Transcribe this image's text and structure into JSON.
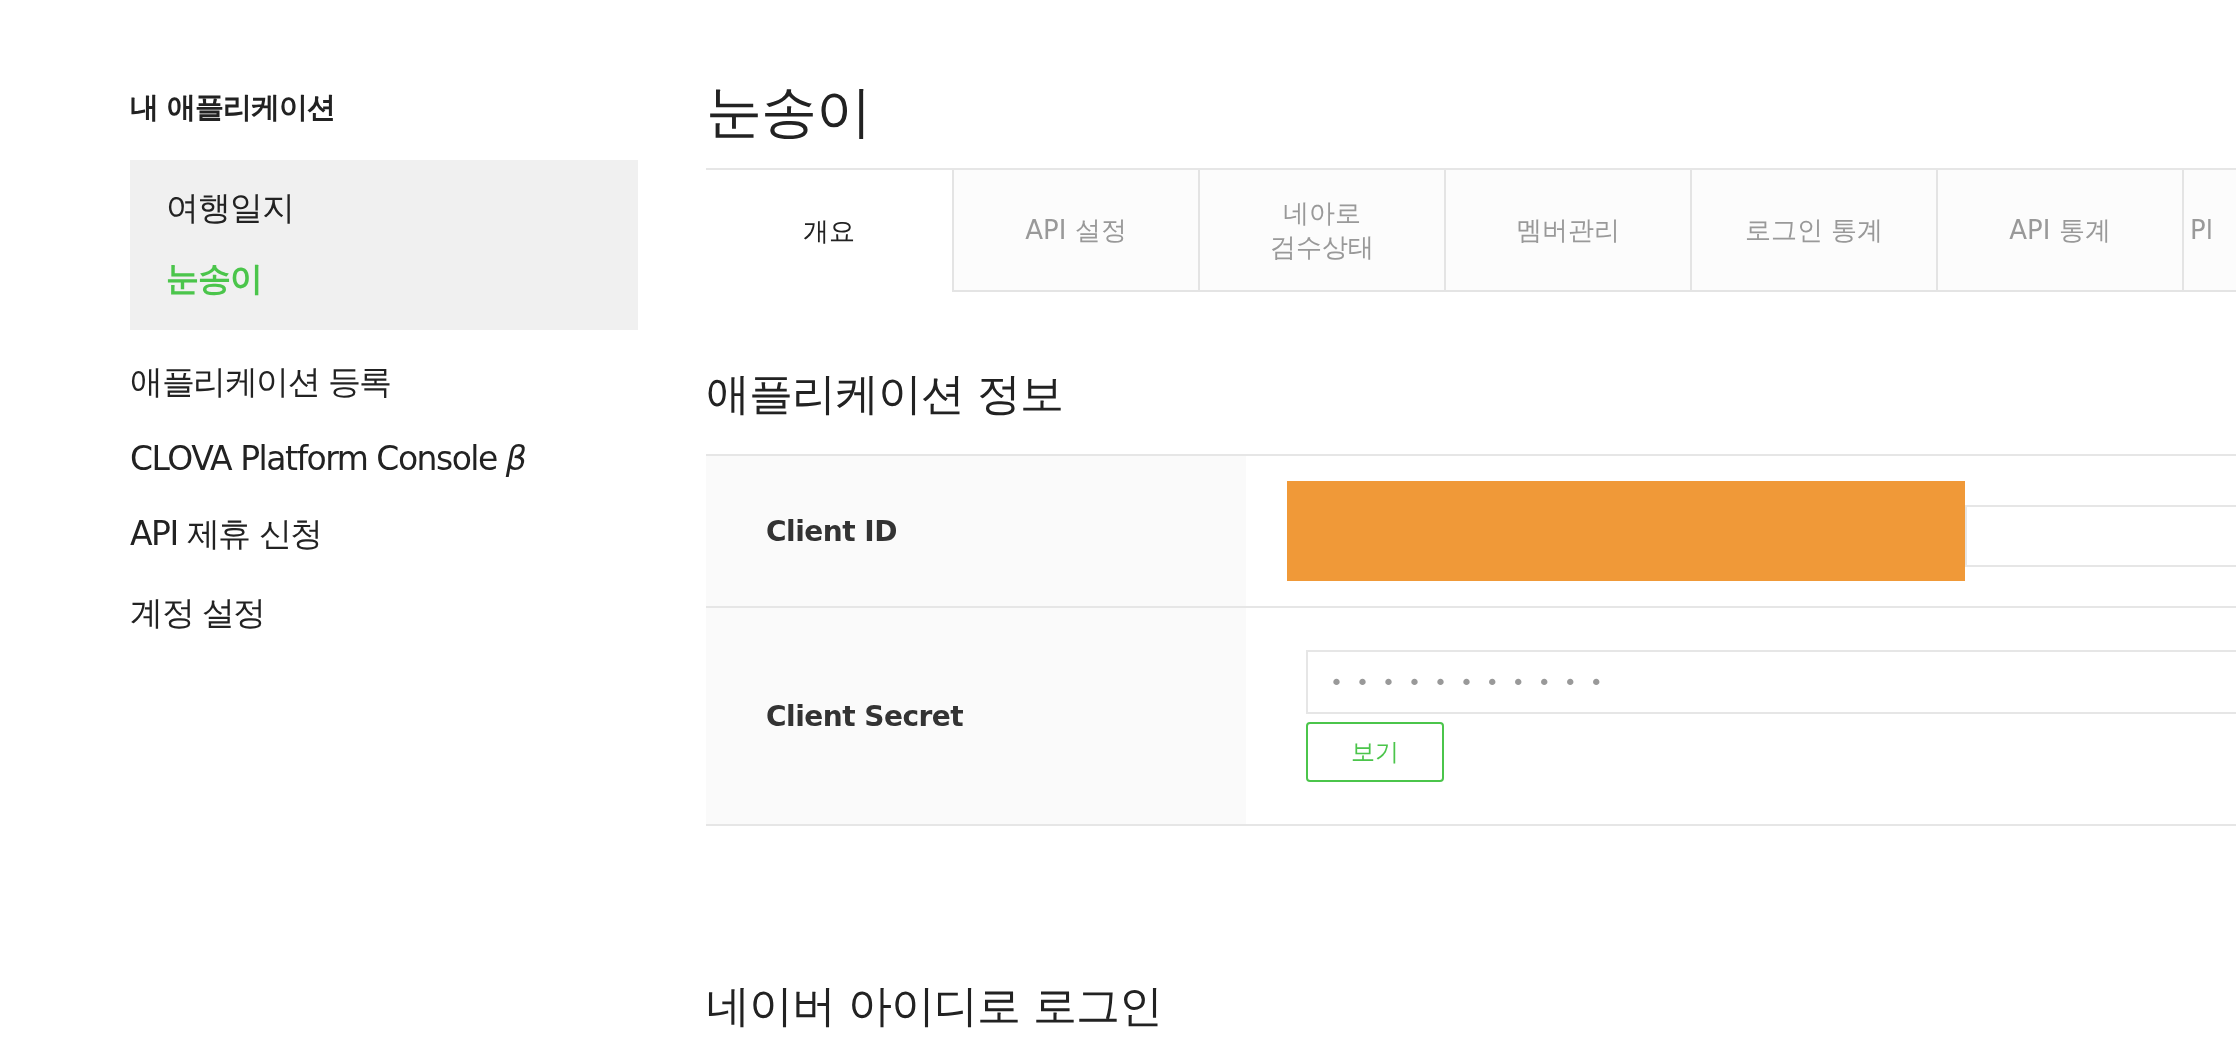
{
  "sidebar": {
    "title": "내 애플리케이션",
    "apps": [
      {
        "label": "여행일지",
        "selected": false
      },
      {
        "label": "눈송이",
        "selected": true
      }
    ],
    "links": [
      "애플리케이션 등록",
      "CLOVA Platform Console *β*",
      "API 제휴 신청",
      "계정 설정"
    ]
  },
  "page_title": "눈송이",
  "tabs": [
    {
      "label": "개요",
      "selected": true
    },
    {
      "label": "API 설정",
      "selected": false
    },
    {
      "label": "네아로\n검수상태",
      "selected": false
    },
    {
      "label": "멤버관리",
      "selected": false
    },
    {
      "label": "로그인 통계",
      "selected": false
    },
    {
      "label": "API 통계",
      "selected": false
    },
    {
      "label": "Pl",
      "selected": false
    }
  ],
  "sections": [
    {
      "heading": "애플리케이션 정보",
      "rows": [
        {
          "label": "Client ID",
          "kind": "redacted"
        },
        {
          "label": "Client Secret",
          "kind": "secret",
          "value": "•••••••••••",
          "button": "보기"
        }
      ]
    },
    {
      "heading": "네이버 아이디로 로그인"
    }
  ]
}
